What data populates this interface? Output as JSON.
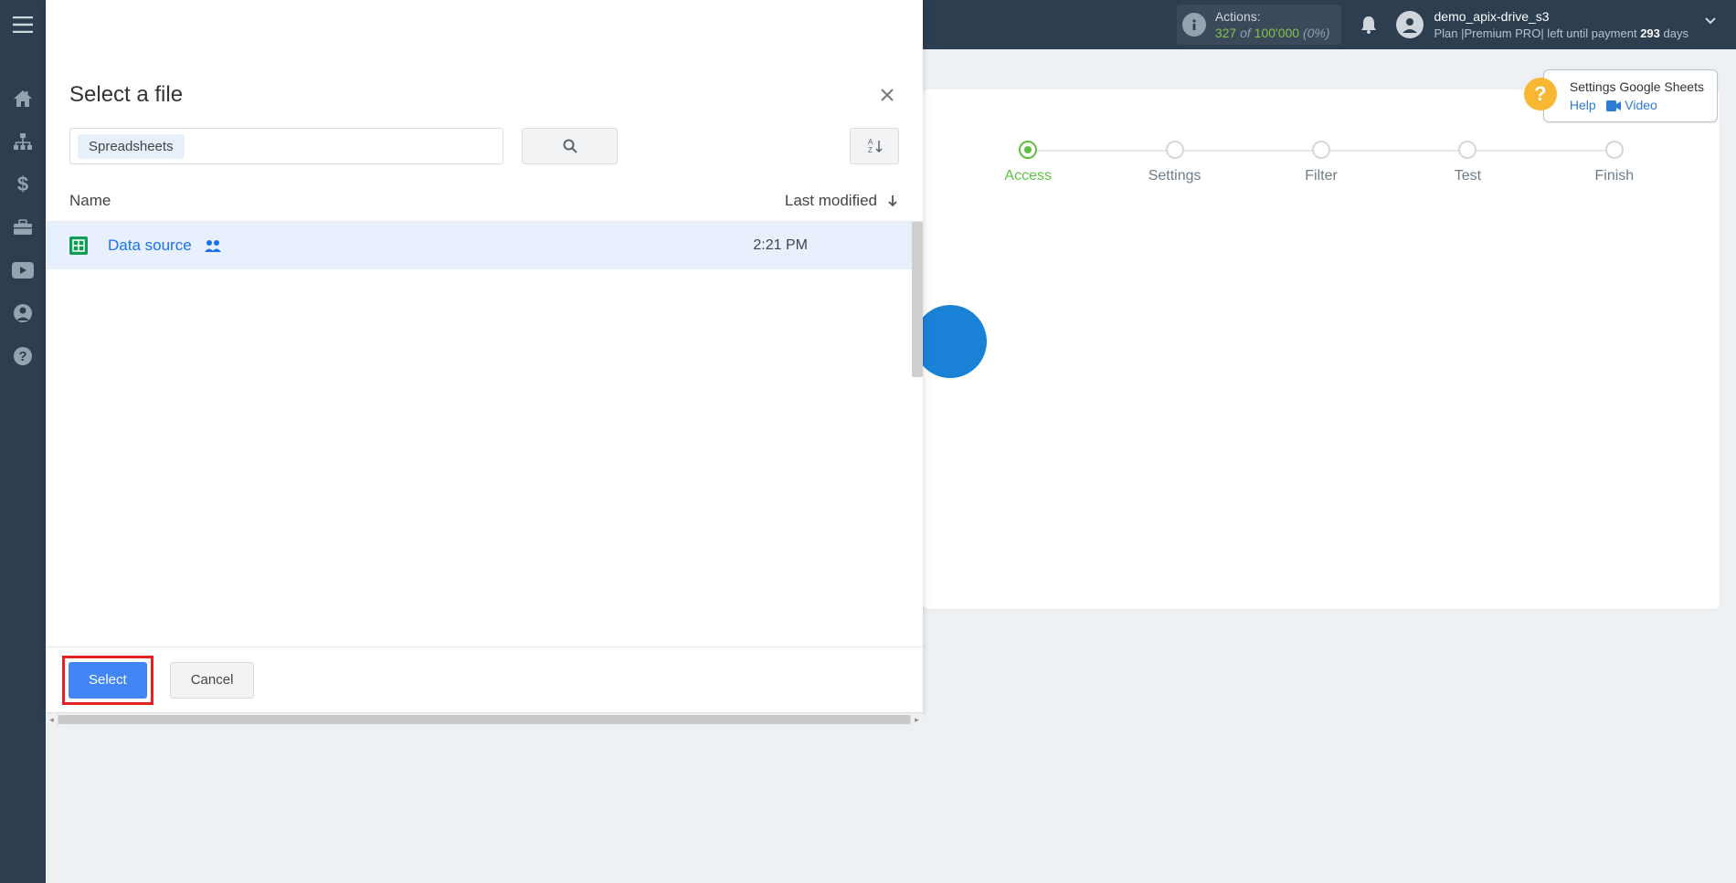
{
  "topbar": {
    "actions_label": "Actions:",
    "actions_count": "327",
    "actions_of": "of",
    "actions_total": "100'000",
    "actions_pct": "(0%)",
    "username": "demo_apix-drive_s3",
    "plan_prefix": "Plan |",
    "plan_name": "Premium PRO",
    "plan_suffix1": "| left until payment",
    "plan_days": "293",
    "plan_suffix2": "days"
  },
  "help": {
    "title": "Settings Google Sheets",
    "help_link": "Help",
    "video_link": "Video"
  },
  "stepper": {
    "steps": [
      "Access",
      "Settings",
      "Filter",
      "Test",
      "Finish"
    ],
    "active_index": 0
  },
  "picker": {
    "title": "Select a file",
    "filter_chip": "Spreadsheets",
    "col_name": "Name",
    "col_modified": "Last modified",
    "rows": [
      {
        "name": "Data source",
        "time": "2:21 PM"
      }
    ],
    "select_label": "Select",
    "cancel_label": "Cancel"
  }
}
